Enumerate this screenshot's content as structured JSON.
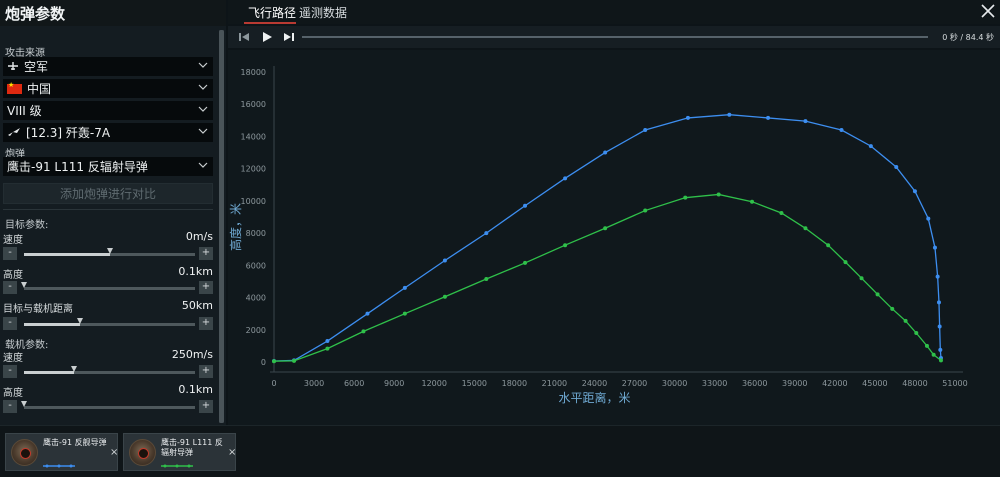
{
  "panel": {
    "title": "炮弹参数",
    "attack_source_label": "攻击来源",
    "branch": "空军",
    "country": "中国",
    "tier": "VIII 级",
    "aircraft": "[12.3] 歼轰-7A",
    "shell_label": "炮弹",
    "shell": "鹰击-91 L111 反辐射导弹",
    "add_compare": "添加炮弹进行对比",
    "target_params_label": "目标参数:",
    "target_speed_label": "速度",
    "target_speed": "0m/s",
    "target_speed_fraction": 0.5,
    "target_alt_label": "高度",
    "target_alt": "0.1km",
    "target_alt_fraction": 0.0,
    "distance_label": "目标与载机距离",
    "distance": "50km",
    "distance_fraction": 0.33,
    "carrier_params_label": "载机参数:",
    "carrier_speed_label": "速度",
    "carrier_speed": "250m/s",
    "carrier_speed_fraction": 0.29,
    "carrier_alt_label": "高度",
    "carrier_alt": "0.1km",
    "carrier_alt_fraction": 0.0,
    "minus": "-",
    "plus": "+"
  },
  "tabs": {
    "flight": "飞行路径",
    "telemetry": "遥测数据"
  },
  "player": {
    "current": "0 秒",
    "sep": "/",
    "total": "84.4 秒"
  },
  "tray": {
    "cards": [
      {
        "name": "鹰击-91 反舰导弹",
        "color": "#3d8ef0"
      },
      {
        "name": "鹰击-91 L111 反辐射导弹",
        "color": "#2fc04a"
      }
    ],
    "close": "×"
  },
  "chart_data": {
    "type": "line",
    "xlabel": "水平距离，米",
    "ylabel": "高度，米",
    "xlim": [
      0,
      51000
    ],
    "ylim": [
      0,
      18000
    ],
    "xticks": [
      0,
      3000,
      6000,
      9000,
      12000,
      15000,
      18000,
      21000,
      24000,
      27000,
      30000,
      33000,
      36000,
      39000,
      42000,
      45000,
      48000,
      51000
    ],
    "yticks": [
      0,
      2000,
      4000,
      6000,
      8000,
      10000,
      12000,
      14000,
      16000,
      18000
    ],
    "series": [
      {
        "name": "鹰击-91 反舰导弹",
        "color": "#3d8ef0",
        "points": [
          [
            0,
            60
          ],
          [
            1500,
            100
          ],
          [
            4000,
            1300
          ],
          [
            7000,
            3000
          ],
          [
            9800,
            4600
          ],
          [
            12800,
            6300
          ],
          [
            15900,
            8000
          ],
          [
            18800,
            9700
          ],
          [
            21800,
            11400
          ],
          [
            24800,
            13000
          ],
          [
            27800,
            14400
          ],
          [
            31000,
            15150
          ],
          [
            34100,
            15350
          ],
          [
            37000,
            15150
          ],
          [
            39800,
            14950
          ],
          [
            42500,
            14400
          ],
          [
            44700,
            13400
          ],
          [
            46600,
            12100
          ],
          [
            48000,
            10600
          ],
          [
            49000,
            8900
          ],
          [
            49500,
            7100
          ],
          [
            49700,
            5300
          ],
          [
            49800,
            3700
          ],
          [
            49850,
            2200
          ],
          [
            49900,
            750
          ],
          [
            49950,
            250
          ]
        ]
      },
      {
        "name": "鹰击-91 L111 反辐射导弹",
        "color": "#2fc04a",
        "points": [
          [
            0,
            50
          ],
          [
            1500,
            70
          ],
          [
            4000,
            830
          ],
          [
            6700,
            1900
          ],
          [
            9800,
            3000
          ],
          [
            12800,
            4050
          ],
          [
            15900,
            5150
          ],
          [
            18800,
            6150
          ],
          [
            21800,
            7250
          ],
          [
            24800,
            8300
          ],
          [
            27800,
            9400
          ],
          [
            30800,
            10200
          ],
          [
            33300,
            10400
          ],
          [
            35800,
            9950
          ],
          [
            38000,
            9250
          ],
          [
            39800,
            8300
          ],
          [
            41500,
            7250
          ],
          [
            42800,
            6200
          ],
          [
            44000,
            5200
          ],
          [
            45200,
            4200
          ],
          [
            46300,
            3300
          ],
          [
            47300,
            2550
          ],
          [
            48100,
            1800
          ],
          [
            48900,
            1000
          ],
          [
            49400,
            450
          ],
          [
            49950,
            100
          ]
        ]
      }
    ]
  }
}
